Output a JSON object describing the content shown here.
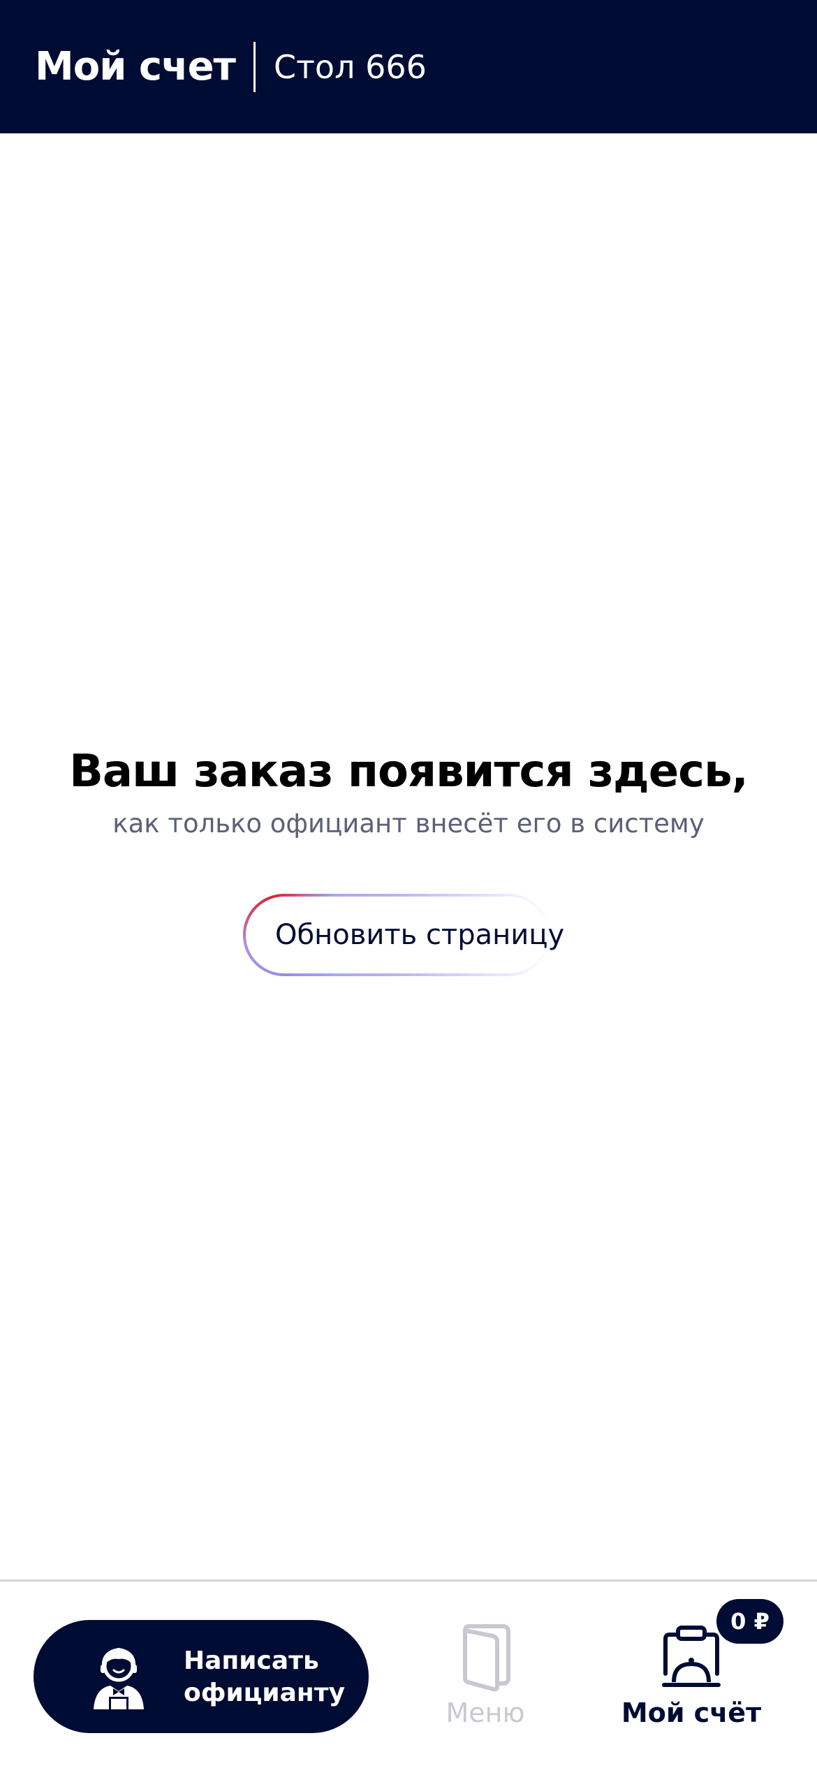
{
  "header": {
    "title": "Мой счет",
    "table": "Стол 666"
  },
  "empty_state": {
    "title": "Ваш заказ появится здесь,",
    "subtitle": "как только официант внесёт его в систему",
    "refresh_label": "Обновить страницу"
  },
  "bottom_nav": {
    "waiter_button": {
      "line1": "Написать",
      "line2": "официанту",
      "icon": "waiter-icon"
    },
    "menu": {
      "label": "Меню",
      "icon": "menu-book-icon",
      "state": "inactive"
    },
    "bill": {
      "label": "Мой счёт",
      "icon": "cloche-clipboard-icon",
      "state": "active",
      "badge": "0 ₽"
    }
  },
  "colors": {
    "primary": "#000c33",
    "background": "#ffffff",
    "subtitle": "#5a6078",
    "inactive": "#c8c9d0",
    "accent_red": "#e11b22",
    "accent_lavender": "#a39ff5"
  }
}
